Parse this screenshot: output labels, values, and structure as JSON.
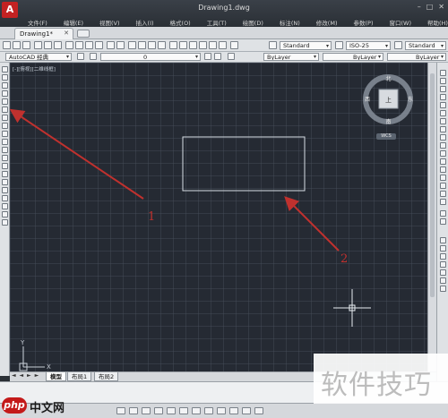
{
  "app": {
    "logo": "A",
    "title": "Drawing1.dwg",
    "window_controls": [
      "–",
      "□",
      "✕"
    ]
  },
  "menu": [
    "文件(F)",
    "编辑(E)",
    "视图(V)",
    "插入(I)",
    "格式(O)",
    "工具(T)",
    "绘图(D)",
    "标注(N)",
    "修改(M)",
    "参数(P)",
    "窗口(W)",
    "帮助(H)"
  ],
  "doc_tab": {
    "label": "Drawing1*",
    "close": "✕"
  },
  "toolbar": {
    "text_style": "Standard",
    "dim_style": "ISO-25",
    "table_style": "Standard",
    "workspace": "AutoCAD 经典",
    "layer": "0",
    "color": "ByLayer",
    "linetype": "ByLayer",
    "lineweight": "ByLayer"
  },
  "canvas": {
    "viewport_label": "[-][俯视][二维线框]",
    "annotations": [
      "1",
      "2"
    ],
    "ucs_x": "X",
    "ucs_y": "Y"
  },
  "viewcube": {
    "north": "北",
    "south": "南",
    "east": "东",
    "west": "西",
    "face": "上",
    "wcs": "WCS"
  },
  "layout_tabs": [
    "模型",
    "布局1",
    "布局2"
  ],
  "layout_nav": "◄ ◄ ► ►",
  "command_line": "",
  "status": {
    "coords": ""
  },
  "watermarks": {
    "php_badge": "php",
    "php_text": "中文网",
    "site_text": "软件技巧"
  },
  "colors": {
    "canvas_bg": "#252a33",
    "arrow": "#c0312e",
    "rectangle": "#d8dde4"
  }
}
